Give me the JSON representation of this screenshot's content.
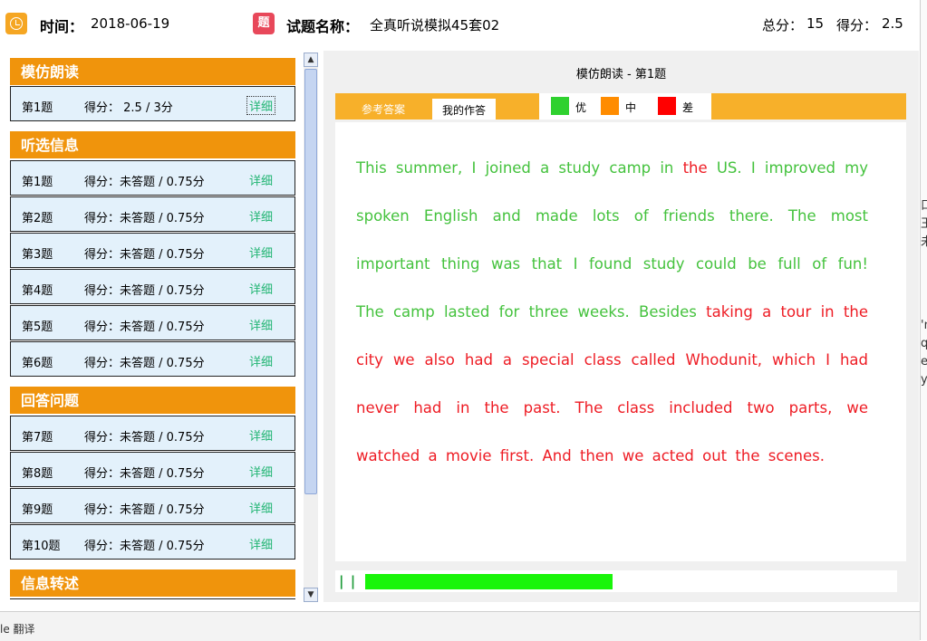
{
  "header": {
    "time_label": "时间：",
    "date": "2018-06-19",
    "ti_icon_text": "题",
    "exam_label": "试题名称：",
    "exam_name": "全真听说模拟45套02",
    "total_label": "总分：",
    "total_value": "15",
    "score_label": "得分：",
    "score_value": "2.5"
  },
  "sidebar": {
    "detail_label": "详细",
    "sections": [
      {
        "title": "模仿朗读",
        "items": [
          {
            "q": "第1题",
            "score": "得分：  2.5 / 3分"
          }
        ]
      },
      {
        "title": "听选信息",
        "items": [
          {
            "q": "第1题",
            "score": "得分：未答题 / 0.75分"
          },
          {
            "q": "第2题",
            "score": "得分：未答题 / 0.75分"
          },
          {
            "q": "第3题",
            "score": "得分：未答题 / 0.75分"
          },
          {
            "q": "第4题",
            "score": "得分：未答题 / 0.75分"
          },
          {
            "q": "第5题",
            "score": "得分：未答题 / 0.75分"
          },
          {
            "q": "第6题",
            "score": "得分：未答题 / 0.75分"
          }
        ]
      },
      {
        "title": "回答问题",
        "items": [
          {
            "q": "第7题",
            "score": "得分：未答题 / 0.75分"
          },
          {
            "q": "第8题",
            "score": "得分：未答题 / 0.75分"
          },
          {
            "q": "第9题",
            "score": "得分：未答题 / 0.75分"
          },
          {
            "q": "第10题",
            "score": "得分：未答题 / 0.75分"
          }
        ]
      },
      {
        "title": "信息转述",
        "items": []
      }
    ]
  },
  "scrollbar": {
    "up_icon": "▲",
    "down_icon": "▼"
  },
  "main": {
    "title": "模仿朗读 - 第1题",
    "tabs": {
      "reference": "参考答案",
      "mine": "我的作答"
    },
    "legend": [
      {
        "label": "优",
        "color": "#2fd12f"
      },
      {
        "label": "中",
        "color": "#ff8c00"
      },
      {
        "label": "差",
        "color": "#ff0000"
      }
    ],
    "passage": {
      "segments": [
        {
          "text": "This summer, I joined a study camp in ",
          "grade": "good"
        },
        {
          "text": "the",
          "grade": "bad"
        },
        {
          "text": " US. I improved my spoken English and made lots of friends there. The most important thing was that I found study could be full of fun! The camp lasted for three weeks. Besides ",
          "grade": "good"
        },
        {
          "text": "taking a tour in the city we also had a special class called Whodunit, which I had never had in the past. The class included two parts, we watched a movie first. And then we acted out the scenes.",
          "grade": "bad"
        }
      ]
    },
    "player": {
      "pause_icon": "| |",
      "progress": 0.44
    }
  },
  "colors": {
    "accent": "#f0940c",
    "tab_bar": "#f7b02a",
    "good_text": "#44c23d",
    "bad_text": "#ee1c24",
    "detail_link": "#22b573",
    "progress": "#19f50a"
  },
  "background": {
    "bottom_text": "le 翻译",
    "right_glyphs": [
      "口",
      "王",
      "未",
      "'n",
      "qu",
      "es",
      "yi"
    ]
  }
}
